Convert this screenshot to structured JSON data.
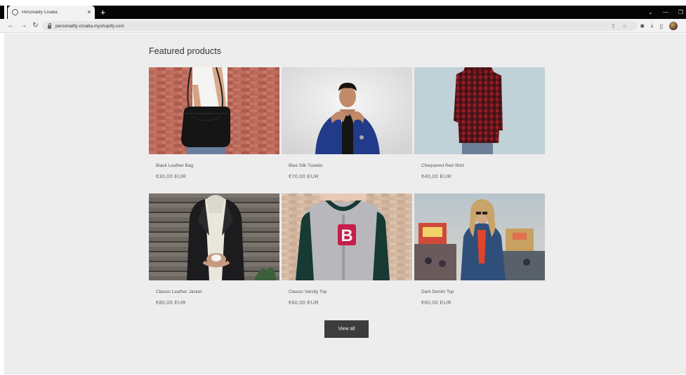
{
  "browser": {
    "tab_title": "Personalify Croatia",
    "tab_close": "×",
    "new_tab": "+",
    "url": "personalify-croatia.myshopify.com"
  },
  "section": {
    "title": "Featured products"
  },
  "products": [
    {
      "name": "Black Leather Bag",
      "price": "€30,00 EUR"
    },
    {
      "name": "Blue Silk Tuxedo",
      "price": "€70,00 EUR"
    },
    {
      "name": "Chequered Red Shirt",
      "price": "€40,00 EUR"
    },
    {
      "name": "Classic Leather Jacket",
      "price": "€80,00 EUR"
    },
    {
      "name": "Classic Varsity Top",
      "price": "€60,00 EUR"
    },
    {
      "name": "Dark Denim Top",
      "price": "€60,00 EUR"
    }
  ],
  "view_all_label": "View all",
  "colors": {
    "page_background": "#ededed",
    "button_background": "#3c3c3c",
    "tab_strip": "#050505"
  }
}
